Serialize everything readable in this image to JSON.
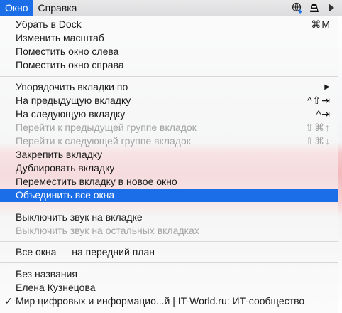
{
  "menubar": {
    "menus": [
      "Окно",
      "Справка"
    ],
    "tray_icons": [
      "globe-download-icon",
      "vlc-cone-icon",
      "arrow-icon"
    ]
  },
  "colors": {
    "highlight": "#1c6ee8",
    "disabled_text": "#a4a4a6"
  },
  "menu": {
    "items": [
      {
        "label": "Убрать в Dock",
        "shortcut": "⌘M"
      },
      {
        "label": "Изменить масштаб",
        "shortcut": ""
      },
      {
        "label": "Поместить окно слева",
        "shortcut": ""
      },
      {
        "label": "Поместить окно справа",
        "shortcut": ""
      },
      {
        "label": "Упорядочить вкладки по",
        "shortcut": "▶"
      },
      {
        "label": "На предыдущую вкладку",
        "shortcut": "^⇧⇥"
      },
      {
        "label": "На следующую вкладку",
        "shortcut": "^⇥"
      },
      {
        "label": "Перейти к предыдущей группе вкладок",
        "shortcut": "⇧⌘↑"
      },
      {
        "label": "Перейти к следующей группе вкладок",
        "shortcut": "⇧⌘↓"
      },
      {
        "label": "Закрепить вкладку",
        "shortcut": ""
      },
      {
        "label": "Дублировать вкладку",
        "shortcut": ""
      },
      {
        "label": "Переместить вкладку в новое окно",
        "shortcut": ""
      },
      {
        "label": "Объединить все окна",
        "shortcut": ""
      },
      {
        "label": "Выключить звук на вкладке",
        "shortcut": ""
      },
      {
        "label": "Выключить звук на остальных вкладках",
        "shortcut": ""
      },
      {
        "label": "Все окна — на передний план",
        "shortcut": ""
      },
      {
        "label": "Без названия",
        "shortcut": ""
      },
      {
        "label": "Елена Кузнецова",
        "shortcut": ""
      },
      {
        "label": "Мир цифровых и информацио...й | IT-World.ru: ИТ-сообщество",
        "shortcut": "",
        "check": "✓"
      }
    ]
  }
}
